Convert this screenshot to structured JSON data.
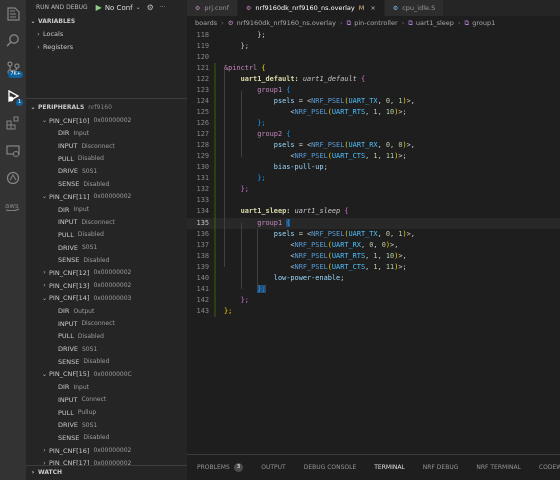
{
  "activity": {
    "account_badge": "1"
  },
  "sidebar": {
    "run_label": "RUN AND DEBUG",
    "config_value": "No Conf",
    "variables_header": "VARIABLES",
    "locals": "Locals",
    "registers": "Registers",
    "peripherals_header": "PERIPHERALS",
    "peripherals_device": "nrf9160",
    "watch_header": "WATCH",
    "tree": [
      {
        "label": "PIN_CNF[10]",
        "value": "0x00000002",
        "level": 1,
        "expanded": true
      },
      {
        "label": "DIR",
        "value": "Input",
        "level": 2
      },
      {
        "label": "INPUT",
        "value": "Disconnect",
        "level": 2
      },
      {
        "label": "PULL",
        "value": "Disabled",
        "level": 2
      },
      {
        "label": "DRIVE",
        "value": "S0S1",
        "level": 2
      },
      {
        "label": "SENSE",
        "value": "Disabled",
        "level": 2
      },
      {
        "label": "PIN_CNF[11]",
        "value": "0x00000002",
        "level": 1,
        "expanded": true
      },
      {
        "label": "DIR",
        "value": "Input",
        "level": 2
      },
      {
        "label": "INPUT",
        "value": "Disconnect",
        "level": 2
      },
      {
        "label": "PULL",
        "value": "Disabled",
        "level": 2
      },
      {
        "label": "DRIVE",
        "value": "S0S1",
        "level": 2
      },
      {
        "label": "SENSE",
        "value": "Disabled",
        "level": 2
      },
      {
        "label": "PIN_CNF[12]",
        "value": "0x00000002",
        "level": 1,
        "expanded": false
      },
      {
        "label": "PIN_CNF[13]",
        "value": "0x00000002",
        "level": 1,
        "expanded": false
      },
      {
        "label": "PIN_CNF[14]",
        "value": "0x00000003",
        "level": 1,
        "expanded": true
      },
      {
        "label": "DIR",
        "value": "Output",
        "level": 2
      },
      {
        "label": "INPUT",
        "value": "Disconnect",
        "level": 2
      },
      {
        "label": "PULL",
        "value": "Disabled",
        "level": 2
      },
      {
        "label": "DRIVE",
        "value": "S0S1",
        "level": 2
      },
      {
        "label": "SENSE",
        "value": "Disabled",
        "level": 2
      },
      {
        "label": "PIN_CNF[15]",
        "value": "0x0000000C",
        "level": 1,
        "expanded": true
      },
      {
        "label": "DIR",
        "value": "Input",
        "level": 2
      },
      {
        "label": "INPUT",
        "value": "Connect",
        "level": 2
      },
      {
        "label": "PULL",
        "value": "Pullup",
        "level": 2
      },
      {
        "label": "DRIVE",
        "value": "S0S1",
        "level": 2
      },
      {
        "label": "SENSE",
        "value": "Disabled",
        "level": 2
      },
      {
        "label": "PIN_CNF[16]",
        "value": "0x00000002",
        "level": 1,
        "expanded": false
      },
      {
        "label": "PIN_CNF[17]",
        "value": "0x00000002",
        "level": 1,
        "expanded": false
      }
    ]
  },
  "tabs": [
    {
      "label": "prj.conf",
      "active": false,
      "modified": false
    },
    {
      "label": "nrf9160dk_nrf9160_ns.overlay",
      "active": true,
      "modified": true,
      "modified_marker": "M"
    },
    {
      "label": "cpu_idle.S",
      "active": false,
      "modified": false
    }
  ],
  "breadcrumb": [
    "boards",
    "nrf9160dk_nrf9160_ns.overlay",
    "pin-controller",
    "uart1_sleep",
    "group1"
  ],
  "editor": {
    "current_line": 135,
    "lines": [
      {
        "n": 118,
        "tokens": [
          [
            "        ",
            ""
          ],
          [
            "};",
            "t-punc"
          ]
        ]
      },
      {
        "n": 119,
        "tokens": [
          [
            "    ",
            ""
          ],
          [
            "};",
            "t-punc"
          ]
        ]
      },
      {
        "n": 120,
        "tokens": []
      },
      {
        "n": 121,
        "tokens": [
          [
            "&pinctrl",
            "t-dir"
          ],
          [
            " ",
            ""
          ],
          [
            "{",
            "t-brace"
          ]
        ]
      },
      {
        "n": 122,
        "tokens": [
          [
            "    ",
            ""
          ],
          [
            "uart1_default:",
            "t-label"
          ],
          [
            " ",
            ""
          ],
          [
            "uart1_default",
            "t-ref"
          ],
          [
            " ",
            ""
          ],
          [
            "{",
            "t-brace2"
          ]
        ]
      },
      {
        "n": 123,
        "tokens": [
          [
            "        ",
            ""
          ],
          [
            "group1",
            "t-node"
          ],
          [
            " ",
            ""
          ],
          [
            "{",
            "t-brace3"
          ]
        ]
      },
      {
        "n": 124,
        "tokens": [
          [
            "            ",
            ""
          ],
          [
            "psels",
            "t-prop"
          ],
          [
            " = <",
            "t-punc"
          ],
          [
            "NRF_PSEL",
            "t-macro"
          ],
          [
            "(",
            "t-brace"
          ],
          [
            "UART_TX",
            "t-const"
          ],
          [
            ", ",
            "t-punc"
          ],
          [
            "0",
            "t-num"
          ],
          [
            ", ",
            "t-punc"
          ],
          [
            "1",
            "t-num"
          ],
          [
            ")",
            "t-brace"
          ],
          [
            ">,",
            "t-punc"
          ]
        ]
      },
      {
        "n": 125,
        "tokens": [
          [
            "                ",
            ""
          ],
          [
            "<",
            "t-punc"
          ],
          [
            "NRF_PSEL",
            "t-macro"
          ],
          [
            "(",
            "t-brace"
          ],
          [
            "UART_RTS",
            "t-const"
          ],
          [
            ", ",
            "t-punc"
          ],
          [
            "1",
            "t-num"
          ],
          [
            ", ",
            "t-punc"
          ],
          [
            "10",
            "t-num"
          ],
          [
            ")",
            "t-brace"
          ],
          [
            ">;",
            "t-punc"
          ]
        ]
      },
      {
        "n": 126,
        "tokens": [
          [
            "        ",
            ""
          ],
          [
            "};",
            "t-brace3"
          ]
        ]
      },
      {
        "n": 127,
        "tokens": [
          [
            "        ",
            ""
          ],
          [
            "group2",
            "t-node"
          ],
          [
            " ",
            ""
          ],
          [
            "{",
            "t-brace3"
          ]
        ]
      },
      {
        "n": 128,
        "tokens": [
          [
            "            ",
            ""
          ],
          [
            "psels",
            "t-prop"
          ],
          [
            " = <",
            "t-punc"
          ],
          [
            "NRF_PSEL",
            "t-macro"
          ],
          [
            "(",
            "t-brace"
          ],
          [
            "UART_RX",
            "t-const"
          ],
          [
            ", ",
            "t-punc"
          ],
          [
            "0",
            "t-num"
          ],
          [
            ", ",
            "t-punc"
          ],
          [
            "0",
            "t-num"
          ],
          [
            ")",
            "t-brace"
          ],
          [
            ">,",
            "t-punc"
          ]
        ]
      },
      {
        "n": 129,
        "tokens": [
          [
            "                ",
            ""
          ],
          [
            "<",
            "t-punc"
          ],
          [
            "NRF_PSEL",
            "t-macro"
          ],
          [
            "(",
            "t-brace"
          ],
          [
            "UART_CTS",
            "t-const"
          ],
          [
            ", ",
            "t-punc"
          ],
          [
            "1",
            "t-num"
          ],
          [
            ", ",
            "t-punc"
          ],
          [
            "11",
            "t-num"
          ],
          [
            ")",
            "t-brace"
          ],
          [
            ">;",
            "t-punc"
          ]
        ]
      },
      {
        "n": 130,
        "tokens": [
          [
            "            ",
            ""
          ],
          [
            "bias-pull-up",
            "t-bool"
          ],
          [
            ";",
            "t-punc"
          ]
        ]
      },
      {
        "n": 131,
        "tokens": [
          [
            "        ",
            ""
          ],
          [
            "};",
            "t-brace3"
          ]
        ]
      },
      {
        "n": 132,
        "tokens": [
          [
            "    ",
            ""
          ],
          [
            "};",
            "t-brace2"
          ]
        ]
      },
      {
        "n": 133,
        "tokens": []
      },
      {
        "n": 134,
        "tokens": [
          [
            "    ",
            ""
          ],
          [
            "uart1_sleep:",
            "t-label"
          ],
          [
            " ",
            ""
          ],
          [
            "uart1_sleep",
            "t-ref"
          ],
          [
            " ",
            ""
          ],
          [
            "{",
            "t-brace2"
          ]
        ]
      },
      {
        "n": 135,
        "tokens": [
          [
            "        ",
            ""
          ],
          [
            "group1",
            "t-node"
          ],
          [
            " ",
            ""
          ],
          [
            "{",
            "t-brace3 sel"
          ]
        ]
      },
      {
        "n": 136,
        "tokens": [
          [
            "            ",
            ""
          ],
          [
            "psels",
            "t-prop"
          ],
          [
            " = <",
            "t-punc"
          ],
          [
            "NRF_PSEL",
            "t-macro"
          ],
          [
            "(",
            "t-brace"
          ],
          [
            "UART_TX",
            "t-const"
          ],
          [
            ", ",
            "t-punc"
          ],
          [
            "0",
            "t-num"
          ],
          [
            ", ",
            "t-punc"
          ],
          [
            "1",
            "t-num"
          ],
          [
            ")",
            "t-brace"
          ],
          [
            ">,",
            "t-punc"
          ]
        ]
      },
      {
        "n": 137,
        "tokens": [
          [
            "                ",
            ""
          ],
          [
            "<",
            "t-punc"
          ],
          [
            "NRF_PSEL",
            "t-macro"
          ],
          [
            "(",
            "t-brace"
          ],
          [
            "UART_RX",
            "t-const"
          ],
          [
            ", ",
            "t-punc"
          ],
          [
            "0",
            "t-num"
          ],
          [
            ", ",
            "t-punc"
          ],
          [
            "0",
            "t-num"
          ],
          [
            ")",
            "t-brace"
          ],
          [
            ">,",
            "t-punc"
          ]
        ]
      },
      {
        "n": 138,
        "tokens": [
          [
            "                ",
            ""
          ],
          [
            "<",
            "t-punc"
          ],
          [
            "NRF_PSEL",
            "t-macro"
          ],
          [
            "(",
            "t-brace"
          ],
          [
            "UART_RTS",
            "t-const"
          ],
          [
            ", ",
            "t-punc"
          ],
          [
            "1",
            "t-num"
          ],
          [
            ", ",
            "t-punc"
          ],
          [
            "10",
            "t-num"
          ],
          [
            ")",
            "t-brace"
          ],
          [
            ">,",
            "t-punc"
          ]
        ]
      },
      {
        "n": 139,
        "tokens": [
          [
            "                ",
            ""
          ],
          [
            "<",
            "t-punc"
          ],
          [
            "NRF_PSEL",
            "t-macro"
          ],
          [
            "(",
            "t-brace"
          ],
          [
            "UART_CTS",
            "t-const"
          ],
          [
            ", ",
            "t-punc"
          ],
          [
            "1",
            "t-num"
          ],
          [
            ", ",
            "t-punc"
          ],
          [
            "11",
            "t-num"
          ],
          [
            ")",
            "t-brace"
          ],
          [
            ">;",
            "t-punc"
          ]
        ]
      },
      {
        "n": 140,
        "tokens": [
          [
            "            ",
            ""
          ],
          [
            "low-power-enable",
            "t-bool"
          ],
          [
            ";",
            "t-punc"
          ]
        ]
      },
      {
        "n": 141,
        "tokens": [
          [
            "        ",
            ""
          ],
          [
            "};",
            "t-brace3 sel"
          ]
        ]
      },
      {
        "n": 142,
        "tokens": [
          [
            "    ",
            ""
          ],
          [
            "};",
            "t-brace2"
          ]
        ]
      },
      {
        "n": 143,
        "tokens": [
          [
            "};",
            "t-brace"
          ]
        ]
      }
    ]
  },
  "panel": {
    "tabs": [
      {
        "label": "PROBLEMS",
        "badge": "3"
      },
      {
        "label": "OUTPUT"
      },
      {
        "label": "DEBUG CONSOLE"
      },
      {
        "label": "TERMINAL",
        "active": true
      },
      {
        "label": "NRF DEBUG"
      },
      {
        "label": "NRF TERMINAL"
      },
      {
        "label": "CODEWHISPERER R"
      }
    ]
  }
}
